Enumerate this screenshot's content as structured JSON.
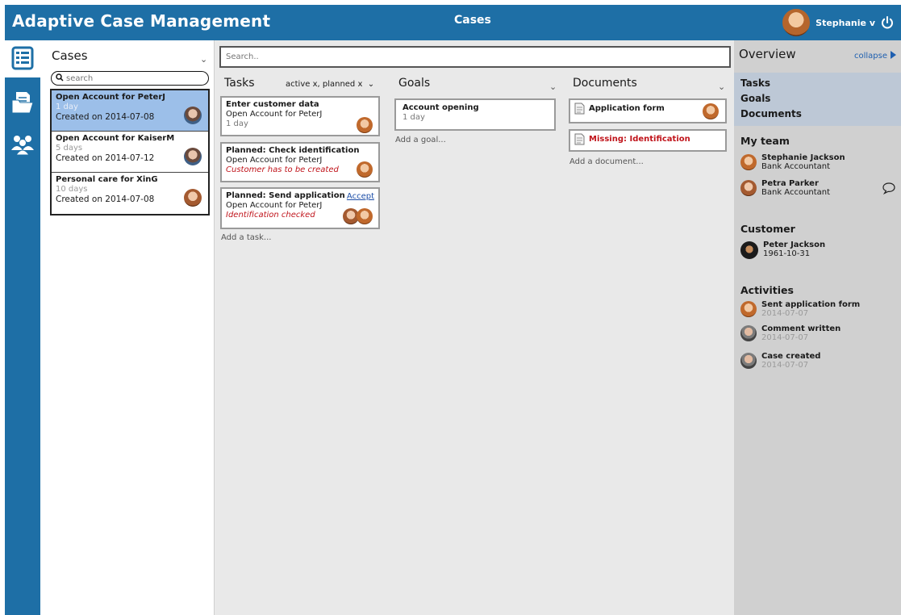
{
  "header": {
    "app_title": "Adaptive Case Management",
    "view_title": "Cases",
    "user_label": "Stephanie v"
  },
  "rail": {
    "items": [
      "case-list-icon",
      "documents-icon",
      "team-icon"
    ],
    "active": "case-list-icon"
  },
  "cases_panel": {
    "title": "Cases",
    "search_placeholder": "search",
    "items": [
      {
        "title": "Open Account for PeterJ",
        "age": "1 day",
        "created": "Created on 2014-07-08",
        "selected": true
      },
      {
        "title": "Open Account for KaiserM",
        "age": "5 days",
        "created": "Created on 2014-07-12",
        "selected": false
      },
      {
        "title": "Personal care for XinG",
        "age": "10 days",
        "created": "Created on 2014-07-08",
        "selected": false
      }
    ]
  },
  "main": {
    "search_placeholder": "Search..",
    "tasks": {
      "title": "Tasks",
      "filter": "active x, planned x",
      "add_label": "Add a task...",
      "cards": [
        {
          "title": "Enter customer data",
          "case": "Open Account for PeterJ",
          "meta": "1 day"
        },
        {
          "title": "Planned: Check identification",
          "case": "Open Account for PeterJ",
          "alert": "Customer has to be created"
        },
        {
          "title": "Planned: Send application",
          "case": "Open Account for PeterJ",
          "alert": "Identification checked",
          "action": "Accept"
        }
      ]
    },
    "goals": {
      "title": "Goals",
      "add_label": "Add a goal...",
      "cards": [
        {
          "title": "Account opening",
          "meta": "1 day"
        }
      ]
    },
    "documents": {
      "title": "Documents",
      "add_label": "Add a document...",
      "cards": [
        {
          "title": "Application form",
          "missing": false
        },
        {
          "title": "Missing: Identification",
          "missing": true
        }
      ]
    }
  },
  "overview": {
    "title": "Overview",
    "collapse_label": "collapse",
    "nav": [
      "Tasks",
      "Goals",
      "Documents"
    ],
    "team_title": "My team",
    "team": [
      {
        "name": "Stephanie Jackson",
        "role": "Bank Accountant"
      },
      {
        "name": "Petra Parker",
        "role": "Bank Accountant"
      }
    ],
    "customer_title": "Customer",
    "customer": {
      "name": "Peter Jackson",
      "birthdate": "1961-10-31"
    },
    "activities_title": "Activities",
    "activities": [
      {
        "label": "Sent application form",
        "date": "2014-07-07"
      },
      {
        "label": "Comment written",
        "date": "2014-07-07"
      },
      {
        "label": "Case created",
        "date": "2014-07-07"
      }
    ]
  },
  "colors": {
    "primary": "#1e6fa6",
    "selected_row": "#9cbfe9",
    "alert": "#c0141b",
    "link": "#1e5fb0"
  }
}
